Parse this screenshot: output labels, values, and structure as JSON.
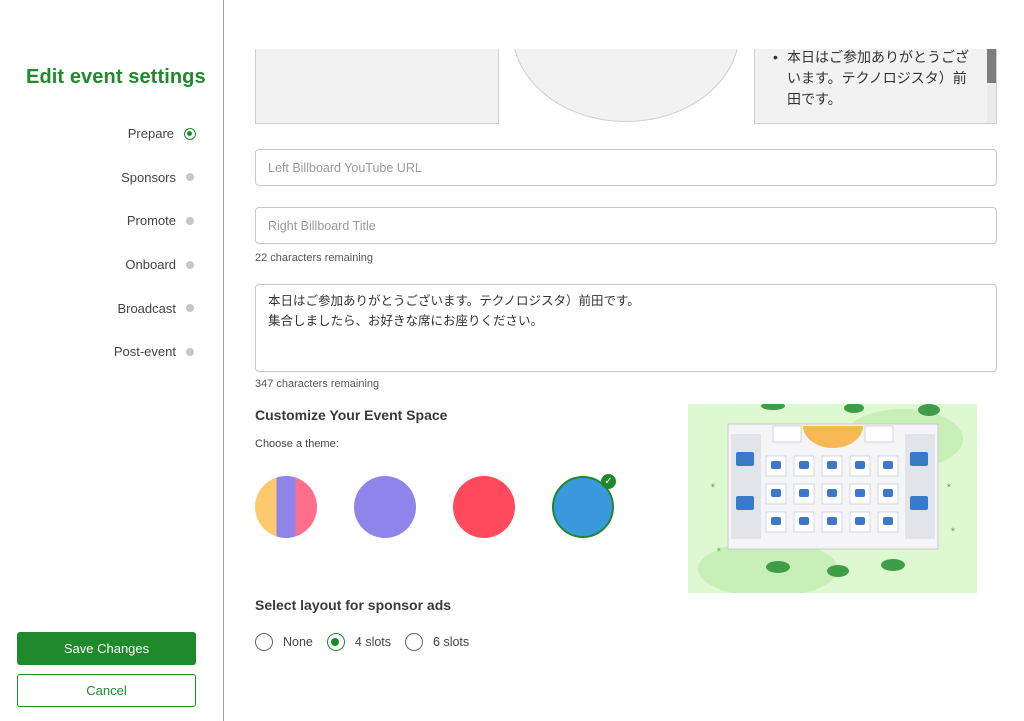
{
  "sidebar": {
    "title": "Edit event settings",
    "items": [
      {
        "label": "Prepare",
        "active": true
      },
      {
        "label": "Sponsors",
        "active": false
      },
      {
        "label": "Promote",
        "active": false
      },
      {
        "label": "Onboard",
        "active": false
      },
      {
        "label": "Broadcast",
        "active": false
      },
      {
        "label": "Post-event",
        "active": false
      }
    ],
    "save_label": "Save Changes",
    "cancel_label": "Cancel"
  },
  "preview_text": "本日はご参加ありがとうございます。テクノロジスタ）前田です。",
  "form": {
    "left_billboard_url_placeholder": "Left Billboard YouTube URL",
    "right_billboard_title_placeholder": "Right Billboard Title",
    "title_remaining": "22 characters remaining",
    "message_value": "本日はご参加ありがとうございます。テクノロジスタ）前田です。\n集合しましたら、お好きな席にお座りください。",
    "message_remaining": "347 characters remaining"
  },
  "customize": {
    "title": "Customize Your Event Space",
    "theme_label": "Choose a theme:",
    "themes": [
      {
        "colors": [
          "#ffc96f",
          "#8f84ea",
          "#ff6f8b"
        ],
        "selected": false
      },
      {
        "colors": [
          "#8f84ea"
        ],
        "selected": false
      },
      {
        "colors": [
          "#ff4a5e"
        ],
        "selected": false
      },
      {
        "colors": [
          "#3a98dc"
        ],
        "selected": true
      }
    ],
    "check_icon": "check-icon"
  },
  "sponsor_layout": {
    "title": "Select layout for sponsor ads",
    "options": [
      {
        "label": "None",
        "selected": false
      },
      {
        "label": "4 slots",
        "selected": true
      },
      {
        "label": "6 slots",
        "selected": false
      }
    ]
  },
  "colors": {
    "brand_green": "#1e8a2c",
    "preview_bg": "#def8d2"
  }
}
